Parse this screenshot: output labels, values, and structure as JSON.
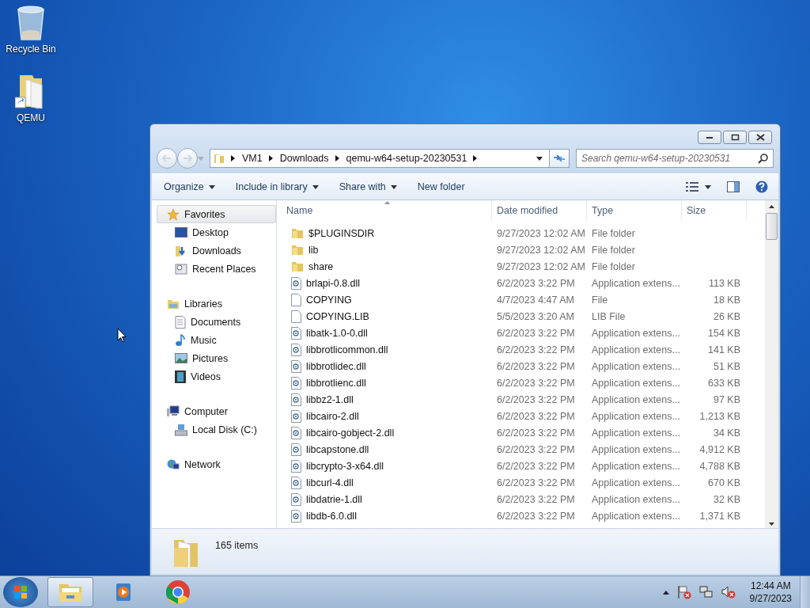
{
  "desktop_icons": [
    {
      "label": "Recycle Bin",
      "kind": "bin"
    },
    {
      "label": "QEMU",
      "kind": "shortcut-folder"
    }
  ],
  "window": {
    "breadcrumb": [
      "VM1",
      "Downloads",
      "qemu-w64-setup-20230531"
    ],
    "search": {
      "placeholder": "Search qemu-w64-setup-20230531"
    },
    "toolbar": [
      {
        "label": "Organize",
        "dropdown": true
      },
      {
        "label": "Include in library",
        "dropdown": true
      },
      {
        "label": "Share with",
        "dropdown": true
      },
      {
        "label": "New folder",
        "dropdown": false
      }
    ],
    "nav": [
      {
        "label": "Favorites",
        "kind": "star",
        "selected": true,
        "children": [
          {
            "label": "Desktop",
            "kind": "desktop",
            "selected": false
          },
          {
            "label": "Downloads",
            "kind": "downloads",
            "selected": false
          },
          {
            "label": "Recent Places",
            "kind": "recent",
            "selected": false
          }
        ]
      },
      {
        "label": "Libraries",
        "kind": "libraries",
        "selected": false,
        "children": [
          {
            "label": "Documents",
            "kind": "documents",
            "selected": false
          },
          {
            "label": "Music",
            "kind": "music",
            "selected": false
          },
          {
            "label": "Pictures",
            "kind": "pictures",
            "selected": false
          },
          {
            "label": "Videos",
            "kind": "videos",
            "selected": false
          }
        ]
      },
      {
        "label": "Computer",
        "kind": "computer",
        "selected": false,
        "children": [
          {
            "label": "Local Disk (C:)",
            "kind": "disk",
            "selected": false
          }
        ]
      },
      {
        "label": "Network",
        "kind": "network",
        "selected": false
      }
    ],
    "columns": [
      "Name",
      "Date modified",
      "Type",
      "Size"
    ],
    "rows": [
      {
        "kind": "folder",
        "name": "$PLUGINSDIR",
        "date": "9/27/2023 12:02 AM",
        "type": "File folder",
        "size": ""
      },
      {
        "kind": "folder",
        "name": "lib",
        "date": "9/27/2023 12:02 AM",
        "type": "File folder",
        "size": ""
      },
      {
        "kind": "folder",
        "name": "share",
        "date": "9/27/2023 12:02 AM",
        "type": "File folder",
        "size": ""
      },
      {
        "kind": "dll",
        "name": "brlapi-0.8.dll",
        "date": "6/2/2023 3:22 PM",
        "type": "Application extens...",
        "size": "113 KB"
      },
      {
        "kind": "file",
        "name": "COPYING",
        "date": "4/7/2023 4:47 AM",
        "type": "File",
        "size": "18 KB"
      },
      {
        "kind": "file",
        "name": "COPYING.LIB",
        "date": "5/5/2023 3:20 AM",
        "type": "LIB File",
        "size": "26 KB"
      },
      {
        "kind": "dll",
        "name": "libatk-1.0-0.dll",
        "date": "6/2/2023 3:22 PM",
        "type": "Application extens...",
        "size": "154 KB"
      },
      {
        "kind": "dll",
        "name": "libbrotlicommon.dll",
        "date": "6/2/2023 3:22 PM",
        "type": "Application extens...",
        "size": "141 KB"
      },
      {
        "kind": "dll",
        "name": "libbrotlidec.dll",
        "date": "6/2/2023 3:22 PM",
        "type": "Application extens...",
        "size": "51 KB"
      },
      {
        "kind": "dll",
        "name": "libbrotlienc.dll",
        "date": "6/2/2023 3:22 PM",
        "type": "Application extens...",
        "size": "633 KB"
      },
      {
        "kind": "dll",
        "name": "libbz2-1.dll",
        "date": "6/2/2023 3:22 PM",
        "type": "Application extens...",
        "size": "97 KB"
      },
      {
        "kind": "dll",
        "name": "libcairo-2.dll",
        "date": "6/2/2023 3:22 PM",
        "type": "Application extens...",
        "size": "1,213 KB"
      },
      {
        "kind": "dll",
        "name": "libcairo-gobject-2.dll",
        "date": "6/2/2023 3:22 PM",
        "type": "Application extens...",
        "size": "34 KB"
      },
      {
        "kind": "dll",
        "name": "libcapstone.dll",
        "date": "6/2/2023 3:22 PM",
        "type": "Application extens...",
        "size": "4,912 KB"
      },
      {
        "kind": "dll",
        "name": "libcrypto-3-x64.dll",
        "date": "6/2/2023 3:22 PM",
        "type": "Application extens...",
        "size": "4,788 KB"
      },
      {
        "kind": "dll",
        "name": "libcurl-4.dll",
        "date": "6/2/2023 3:22 PM",
        "type": "Application extens...",
        "size": "670 KB"
      },
      {
        "kind": "dll",
        "name": "libdatrie-1.dll",
        "date": "6/2/2023 3:22 PM",
        "type": "Application extens...",
        "size": "32 KB"
      },
      {
        "kind": "dll",
        "name": "libdb-6.0.dll",
        "date": "6/2/2023 3:22 PM",
        "type": "Application extens...",
        "size": "1,371 KB"
      }
    ],
    "status": "165 items"
  },
  "taskbar": {
    "apps": [
      {
        "kind": "explorer",
        "active": true
      },
      {
        "kind": "media-player",
        "active": false
      },
      {
        "kind": "browser",
        "active": false
      }
    ],
    "time": "12:44 AM",
    "date": "9/27/2023"
  }
}
